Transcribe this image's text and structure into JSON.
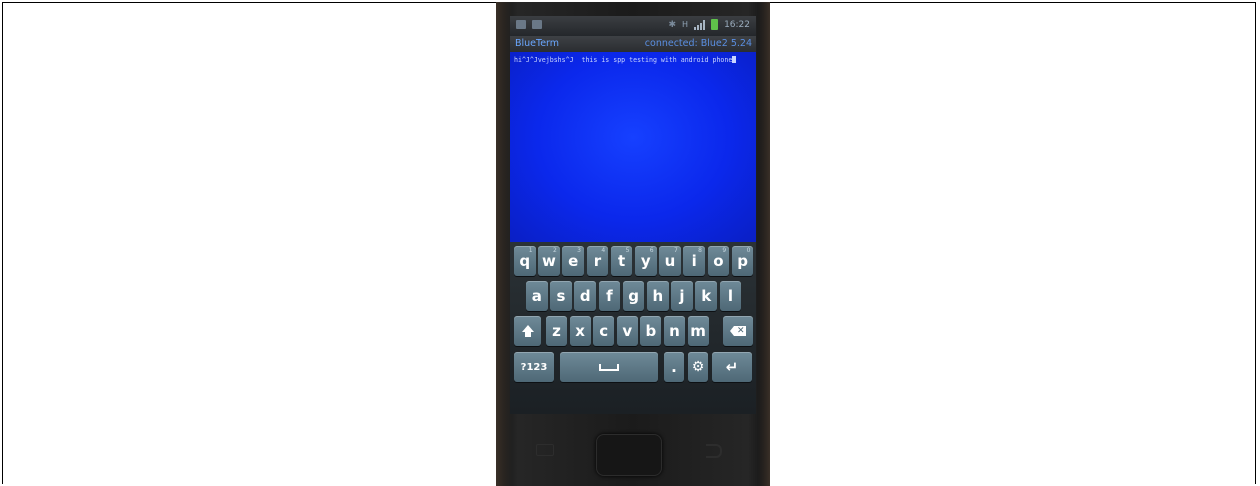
{
  "statusbar": {
    "time": "16:22",
    "network": "H",
    "icons": [
      "gallery-icon",
      "camera-icon",
      "bluetooth-icon",
      "h-network-icon",
      "signal-icon",
      "battery-icon"
    ]
  },
  "app": {
    "title": "BlueTerm",
    "connection_status": "connected: Blue2 5.24"
  },
  "terminal": {
    "text": "hi^J^Jvejbshs^J  this is spp testing with android phone",
    "background": "#0b28ec",
    "text_color": "#c9d4ff"
  },
  "keyboard": {
    "row1": [
      {
        "key": "q",
        "hint": "1"
      },
      {
        "key": "w",
        "hint": "2"
      },
      {
        "key": "e",
        "hint": "3"
      },
      {
        "key": "r",
        "hint": "4"
      },
      {
        "key": "t",
        "hint": "5"
      },
      {
        "key": "y",
        "hint": "6"
      },
      {
        "key": "u",
        "hint": "7"
      },
      {
        "key": "i",
        "hint": "8"
      },
      {
        "key": "o",
        "hint": "9"
      },
      {
        "key": "p",
        "hint": "0"
      }
    ],
    "row2": [
      "a",
      "s",
      "d",
      "f",
      "g",
      "h",
      "j",
      "k",
      "l"
    ],
    "row3": [
      "z",
      "x",
      "c",
      "v",
      "b",
      "n",
      "m"
    ],
    "row4": {
      "symbols": "?123",
      "period": "."
    },
    "key_color": "#5f7a88",
    "special_icons": [
      "shift-icon",
      "backspace-icon",
      "space-icon",
      "settings-gear-icon",
      "enter-icon"
    ]
  },
  "hardware_buttons": [
    "menu-button",
    "home-button",
    "back-button"
  ]
}
